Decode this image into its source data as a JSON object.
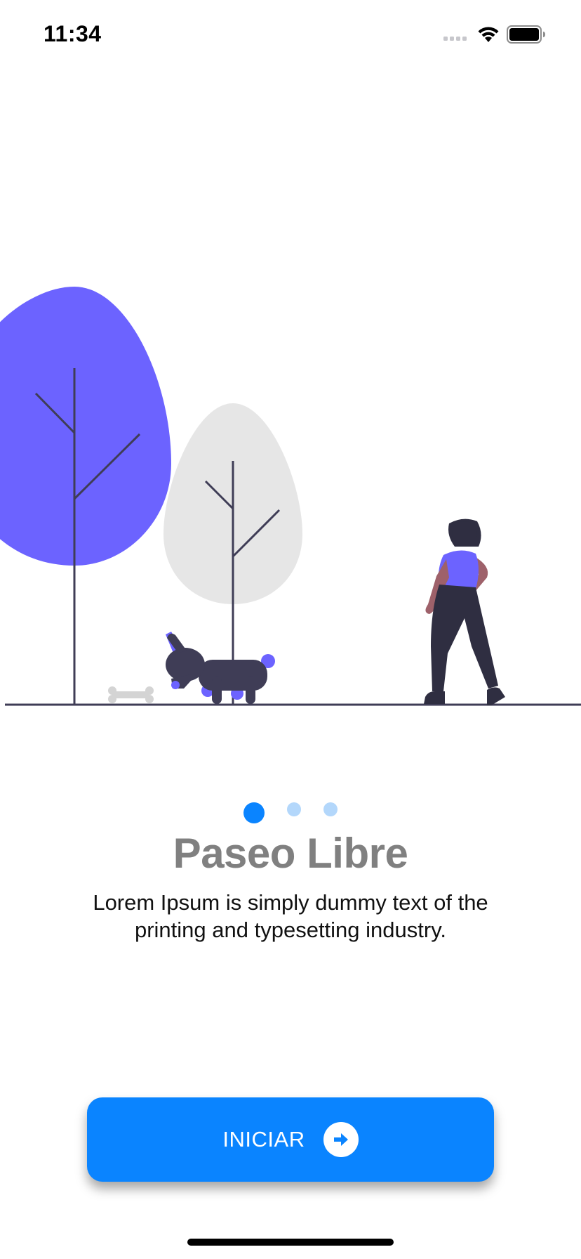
{
  "status_bar": {
    "time": "11:34",
    "icons": [
      "cellular-signal-icon",
      "wifi-icon",
      "battery-icon"
    ]
  },
  "illustration": {
    "name": "woman-walking-dog-illustration",
    "colors": {
      "purple": "#6c63ff",
      "gray_tree": "#e6e6e6",
      "dark": "#3f3d56",
      "skin": "#9e616a",
      "bone": "#d4d4d4"
    }
  },
  "pager": {
    "total": 3,
    "active_index": 0,
    "active_color": "#0a84ff",
    "inactive_color": "#b3d7fb"
  },
  "onboarding": {
    "title": "Paseo Libre",
    "description": "Lorem Ipsum is simply dummy text of the printing and typesetting industry."
  },
  "start_button": {
    "label": "INICIAR",
    "color": "#0a84ff",
    "icon": "arrow-right-circle-icon"
  }
}
